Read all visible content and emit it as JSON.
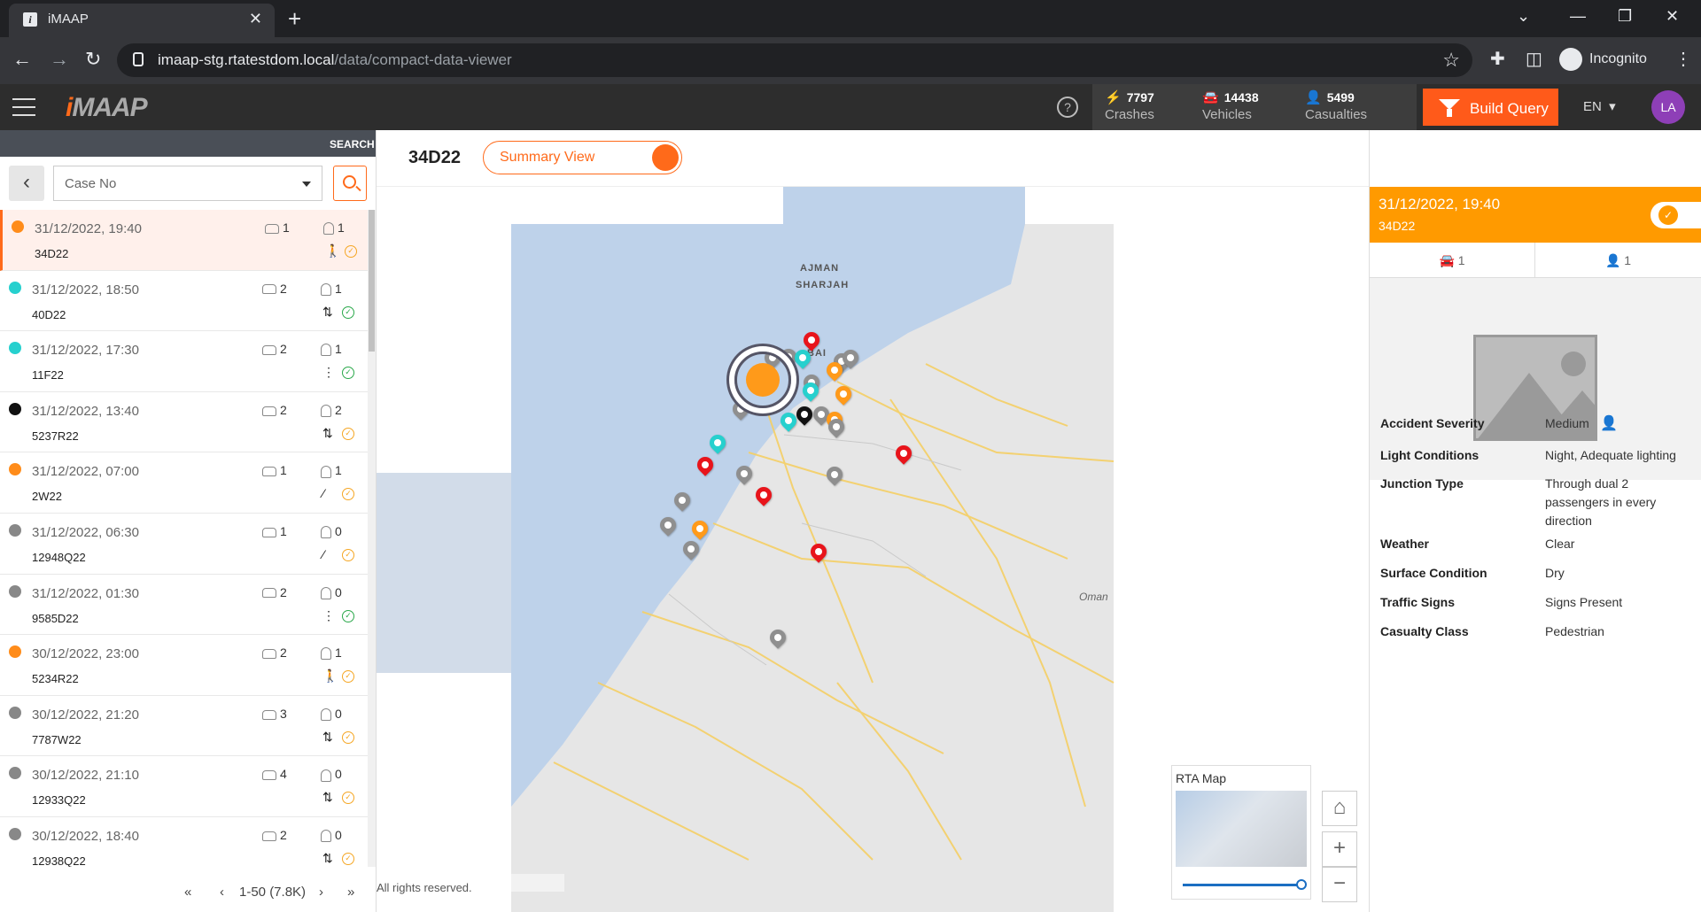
{
  "browser": {
    "tab_title": "iMAAP",
    "url_host": "imaap-stg.rtatestdom.local",
    "url_path": "/data/compact-data-viewer",
    "incognito_label": "Incognito"
  },
  "app": {
    "logo": "iMAAP",
    "stats": [
      {
        "value": "7797",
        "label": "Crashes"
      },
      {
        "value": "14438",
        "label": "Vehicles"
      },
      {
        "value": "5499",
        "label": "Casualties"
      }
    ],
    "build_query": "Build Query",
    "language": "EN",
    "avatar": "LA"
  },
  "left": {
    "search_label": "SEARCH",
    "case_placeholder": "Case No",
    "rows": [
      {
        "datetime": "31/12/2022, 19:40",
        "case": "34D22",
        "vehicles": "1",
        "casualties": "1",
        "dot": "#ff8c1a",
        "ped": "🚶",
        "check": "orange"
      },
      {
        "datetime": "31/12/2022, 18:50",
        "case": "40D22",
        "vehicles": "2",
        "casualties": "1",
        "dot": "#26d0ce",
        "ped": "⇅",
        "check": "green"
      },
      {
        "datetime": "31/12/2022, 17:30",
        "case": "11F22",
        "vehicles": "2",
        "casualties": "1",
        "dot": "#26d0ce",
        "ped": "⋮",
        "check": "green"
      },
      {
        "datetime": "31/12/2022, 13:40",
        "case": "5237R22",
        "vehicles": "2",
        "casualties": "2",
        "dot": "#111111",
        "ped": "⇅",
        "check": "orange"
      },
      {
        "datetime": "31/12/2022, 07:00",
        "case": "2W22",
        "vehicles": "1",
        "casualties": "1",
        "dot": "#ff8c1a",
        "ped": "⁄",
        "check": "orange"
      },
      {
        "datetime": "31/12/2022, 06:30",
        "case": "12948Q22",
        "vehicles": "1",
        "casualties": "0",
        "dot": "#888888",
        "ped": "⁄",
        "check": "orange"
      },
      {
        "datetime": "31/12/2022, 01:30",
        "case": "9585D22",
        "vehicles": "2",
        "casualties": "0",
        "dot": "#888888",
        "ped": "⋮",
        "check": "green"
      },
      {
        "datetime": "30/12/2022, 23:00",
        "case": "5234R22",
        "vehicles": "2",
        "casualties": "1",
        "dot": "#ff8c1a",
        "ped": "🚶",
        "check": "orange"
      },
      {
        "datetime": "30/12/2022, 21:20",
        "case": "7787W22",
        "vehicles": "3",
        "casualties": "0",
        "dot": "#888888",
        "ped": "⇅",
        "check": "orange"
      },
      {
        "datetime": "30/12/2022, 21:10",
        "case": "12933Q22",
        "vehicles": "4",
        "casualties": "0",
        "dot": "#888888",
        "ped": "⇅",
        "check": "orange"
      },
      {
        "datetime": "30/12/2022, 18:40",
        "case": "12938Q22",
        "vehicles": "2",
        "casualties": "0",
        "dot": "#888888",
        "ped": "⇅",
        "check": "orange"
      }
    ],
    "pager": "1-50 (7.8K)"
  },
  "center": {
    "case_title": "34D22",
    "summary_toggle": "Summary View",
    "rights": "All rights reserved.",
    "minimap_title": "RTA Map",
    "map_labels": {
      "ajman": "AJMAN",
      "sharjah": "SHARJAH",
      "dubai": "BAI",
      "oman": "Oman"
    }
  },
  "right": {
    "datetime": "31/12/2022, 19:40",
    "case": "34D22",
    "vehicles": "1",
    "casualties": "1",
    "props": [
      {
        "label": "Accident Severity",
        "value": "Medium"
      },
      {
        "label": "Light Conditions",
        "value": "Night, Adequate lighting"
      },
      {
        "label": "Junction Type",
        "value": "Through dual 2 passengers in every direction"
      },
      {
        "label": "Weather",
        "value": "Clear"
      },
      {
        "label": "Surface Condition",
        "value": "Dry"
      },
      {
        "label": "Traffic Signs",
        "value": "Signs Present"
      },
      {
        "label": "Casualty Class",
        "value": "Pedestrian"
      }
    ]
  },
  "colors": {
    "accent": "#ff5a1a",
    "panel_header": "#ff9a00",
    "red_pin": "#e8141b",
    "gray_pin": "#8f8f8f",
    "cyan_pin": "#26d0ce"
  }
}
